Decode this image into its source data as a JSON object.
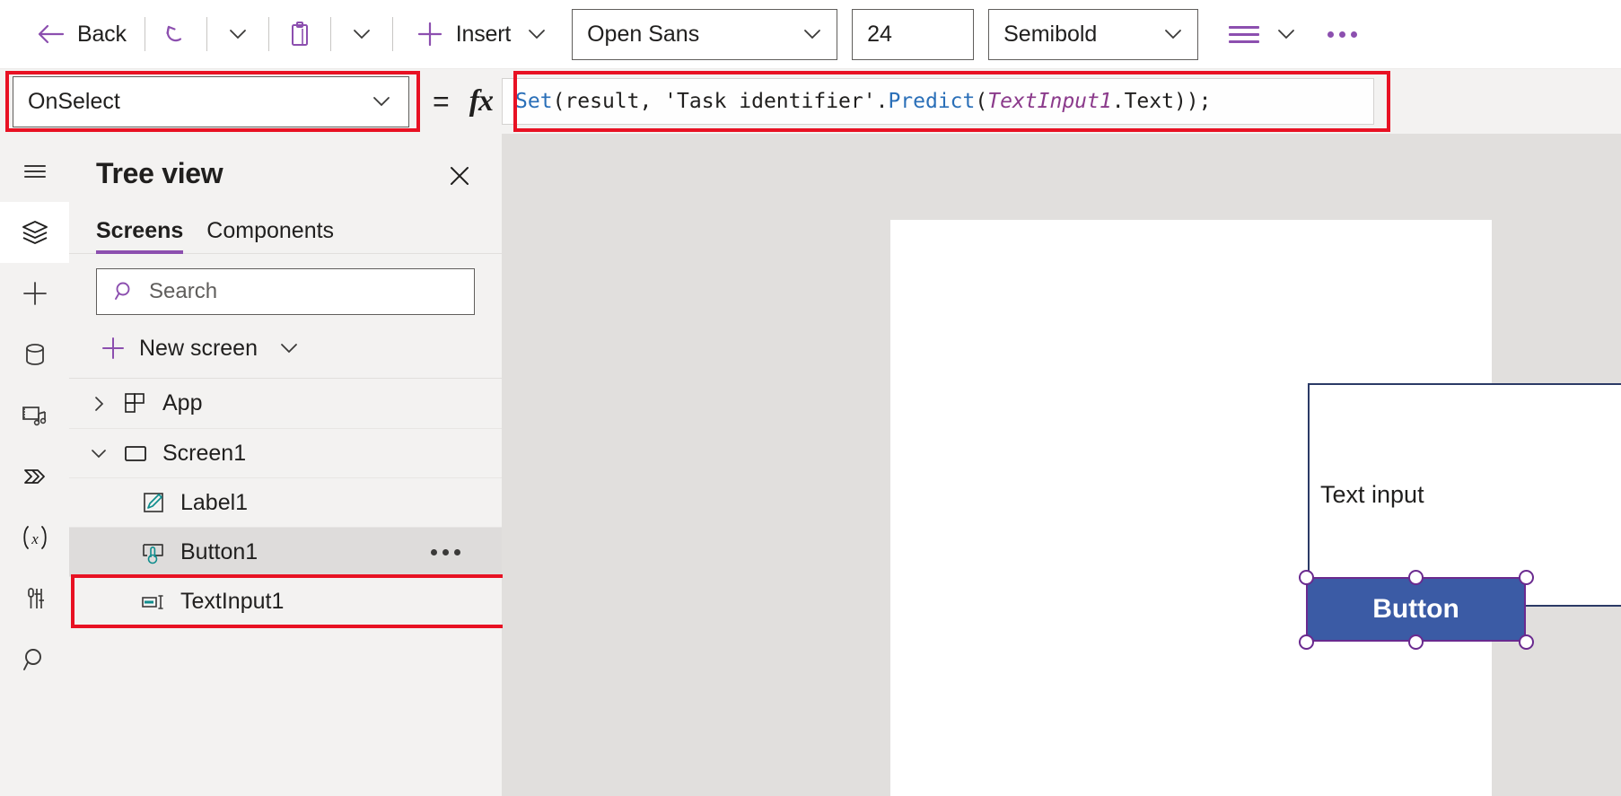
{
  "toolbar": {
    "back_label": "Back",
    "undo_icon": "undo-icon",
    "paste_icon": "clipboard-icon",
    "insert_label": "Insert",
    "font_family": "Open Sans",
    "font_size": "24",
    "font_weight": "Semibold",
    "align_icon": "align-list-icon",
    "overflow_icon": "ellipsis-icon"
  },
  "formula_bar": {
    "property": "OnSelect",
    "equals": "=",
    "fx": "fx",
    "formula": "Set(result, 'Task identifier'.Predict(TextInput1.Text));",
    "tokens": [
      {
        "text": "Set",
        "type": "fn"
      },
      {
        "text": "(result, 'Task identifier'.",
        "type": "plain"
      },
      {
        "text": "Predict",
        "type": "fn"
      },
      {
        "text": "(",
        "type": "plain"
      },
      {
        "text": "TextInput1",
        "type": "ctrl"
      },
      {
        "text": ".Text));",
        "type": "plain"
      }
    ]
  },
  "rail": {
    "items": [
      {
        "name": "hamburger-menu-icon",
        "active": false
      },
      {
        "name": "tree-view-layers-icon",
        "active": true
      },
      {
        "name": "insert-plus-icon",
        "active": false
      },
      {
        "name": "data-cylinder-icon",
        "active": false
      },
      {
        "name": "media-icon",
        "active": false
      },
      {
        "name": "power-automate-icon",
        "active": false
      },
      {
        "name": "variables-fx-icon",
        "active": false
      },
      {
        "name": "app-checker-icon",
        "active": false
      },
      {
        "name": "search-rail-icon",
        "active": false
      }
    ]
  },
  "tree_view": {
    "title": "Tree view",
    "close_icon": "close-icon",
    "tabs": [
      {
        "label": "Screens",
        "active": true
      },
      {
        "label": "Components",
        "active": false
      }
    ],
    "search_placeholder": "Search",
    "search_value": "",
    "new_screen_label": "New screen",
    "items": [
      {
        "label": "App",
        "icon": "app-grid-icon",
        "twist": "chevron-right",
        "indent": 0,
        "selected": false,
        "dots": false
      },
      {
        "label": "Screen1",
        "icon": "screen-rect-icon",
        "twist": "chevron-down",
        "indent": 0,
        "selected": false,
        "dots": false
      },
      {
        "label": "Label1",
        "icon": "label-pencil-icon",
        "twist": "none",
        "indent": 1,
        "selected": false,
        "dots": false
      },
      {
        "label": "Button1",
        "icon": "button-click-icon",
        "twist": "none",
        "indent": 1,
        "selected": true,
        "dots": true
      },
      {
        "label": "TextInput1",
        "icon": "textinput-icon",
        "twist": "none",
        "indent": 1,
        "selected": false,
        "dots": false
      }
    ]
  },
  "canvas": {
    "text_input_value": "Text input",
    "button_label": "Button"
  },
  "colors": {
    "accent_purple": "#8c4faf",
    "annotation_red": "#e81123",
    "formula_fn_blue": "#2a6fb8",
    "formula_ctrl_purple": "#8b3a8b",
    "button_fill": "#3b5ba5",
    "button_border": "#6a2a8f",
    "teal_icon": "#0f8d8d",
    "selected_row": "#dedcdb"
  }
}
